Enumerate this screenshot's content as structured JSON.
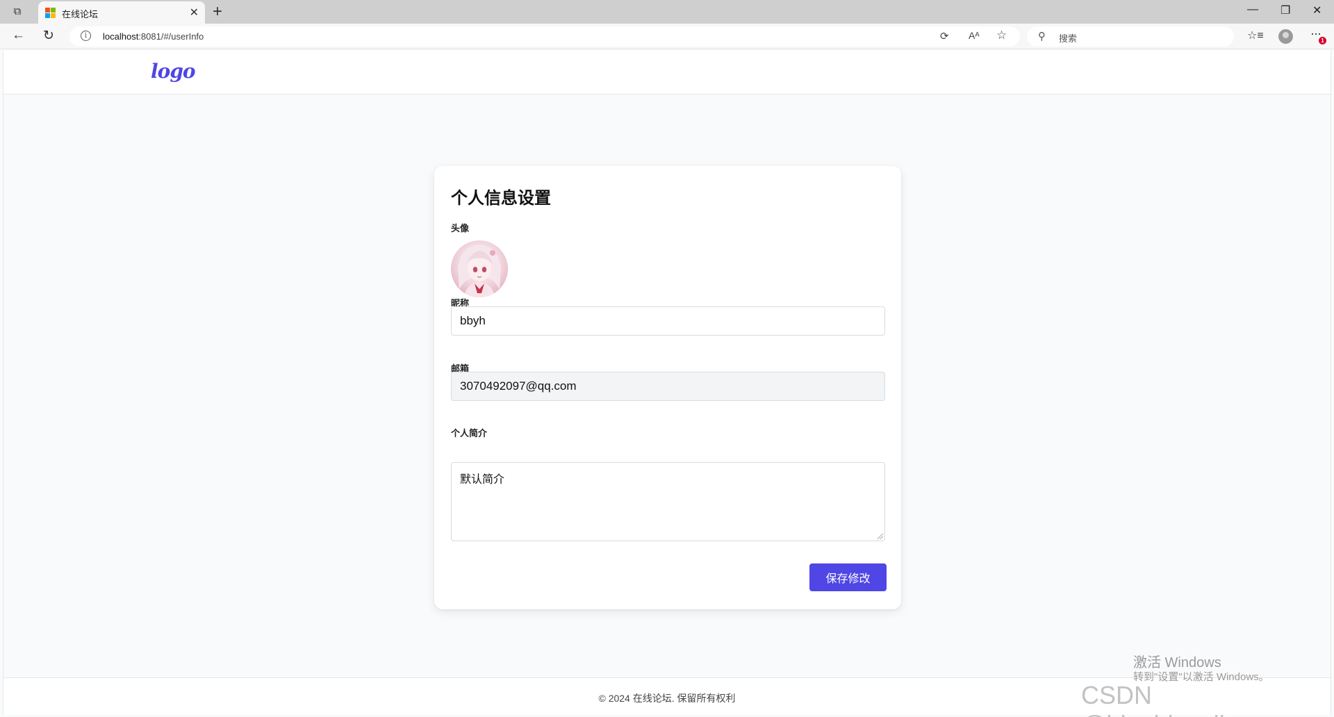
{
  "browser": {
    "tab_title": "在线论坛",
    "url_host": "localhost",
    "url_rest": ":8081/#/userInfo",
    "search_placeholder": "搜索",
    "close_tab_glyph": "✕",
    "new_tab_glyph": "+",
    "more_glyph": "···",
    "notification_count": "1"
  },
  "header": {
    "logo_text": "logo"
  },
  "profile": {
    "title": "个人信息设置",
    "avatar_label": "头像",
    "nickname_label": "昵称",
    "nickname_value": "bbyh",
    "email_label": "邮箱",
    "email_value": "3070492097@qq.com",
    "bio_label": "个人简介",
    "bio_value": "默认简介",
    "save_label": "保存修改"
  },
  "footer": {
    "copyright": "© 2024 在线论坛. 保留所有权利"
  },
  "overlay": {
    "activate_title": "激活 Windows",
    "activate_sub": "转到\"设置\"以激活 Windows。",
    "watermark": "CSDN @bingbingyihao"
  },
  "colors": {
    "accent": "#4f46e5",
    "page_bg": "#f9fafb"
  }
}
